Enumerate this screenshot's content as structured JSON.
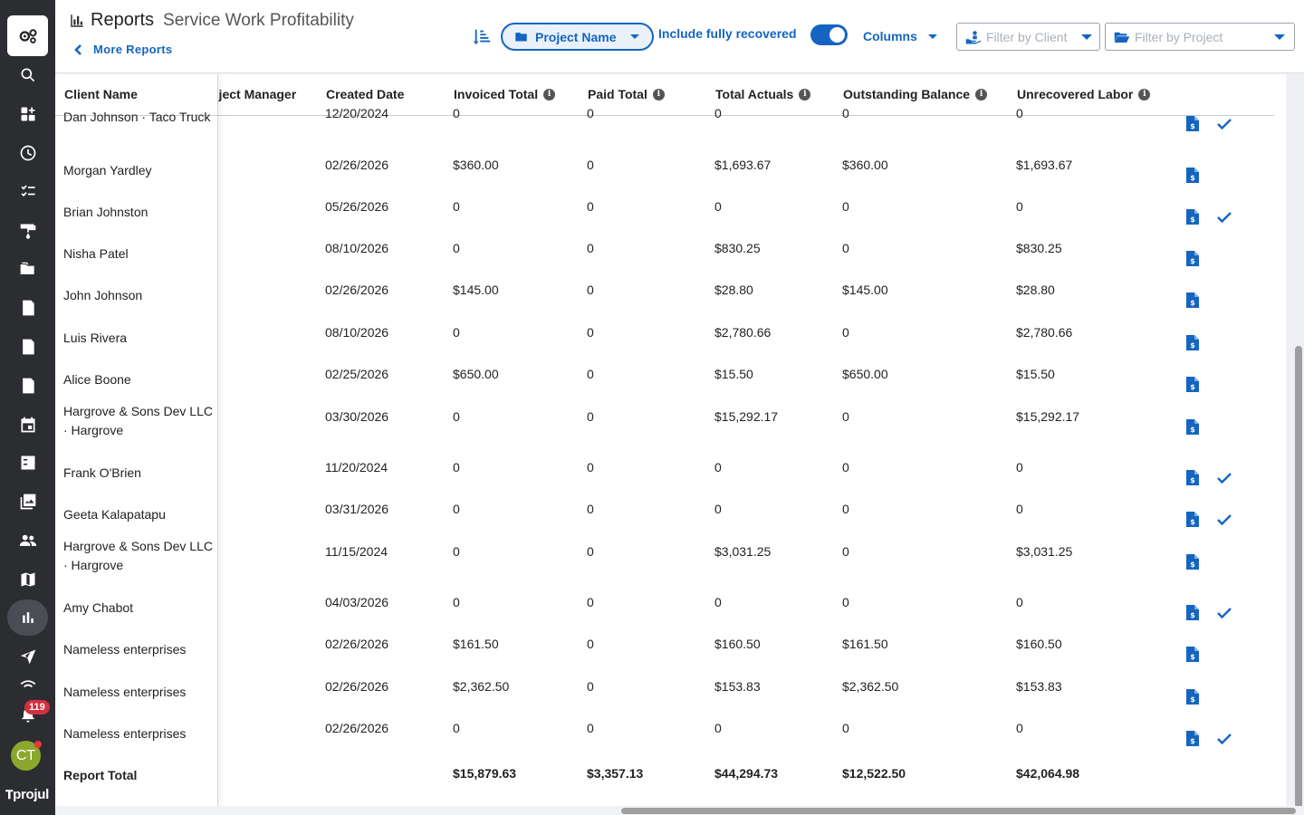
{
  "header": {
    "title": "Reports",
    "subtitle": "Service Work Profitability",
    "more_reports": "More Reports",
    "group_by": "Project Name",
    "include_recovered_label": "Include fully recovered",
    "include_recovered_on": true,
    "columns_label": "Columns",
    "filter_client_placeholder": "Filter by Client",
    "filter_project_placeholder": "Filter by Project"
  },
  "nav": {
    "notification_count": "119",
    "avatar_initials": "CT",
    "brand": "projul",
    "icons": [
      "settings-gears-icon",
      "search-icon",
      "dashboard-add-icon",
      "clock-icon",
      "checklist-icon",
      "paint-roller-icon",
      "folder-icon",
      "estimate-icon",
      "invoice-icon",
      "change-order-icon",
      "calendar-icon",
      "task-icon",
      "photos-icon",
      "users-icon",
      "map-icon",
      "reports-icon",
      "send-icon",
      "wifi-icon",
      "bell-icon"
    ]
  },
  "table": {
    "columns": {
      "client_name": "Client Name",
      "project_manager": "oject Manager",
      "created_date": "Created Date",
      "invoiced_total": "Invoiced Total",
      "paid_total": "Paid Total",
      "total_actuals": "Total Actuals",
      "outstanding_balance": "Outstanding Balance",
      "unrecovered_labor": "Unrecovered Labor"
    },
    "rows": [
      {
        "client": "Dan Johnson · Taco Truck",
        "date": "12/20/2024",
        "invoiced": "0",
        "paid": "0",
        "actuals": "0",
        "outstanding": "0",
        "unrecovered": "0",
        "check": true
      },
      {
        "client": "Morgan Yardley",
        "date": "02/26/2026",
        "invoiced": "$360.00",
        "paid": "0",
        "actuals": "$1,693.67",
        "outstanding": "$360.00",
        "unrecovered": "$1,693.67",
        "check": false
      },
      {
        "client": "Brian Johnston",
        "date": "05/26/2026",
        "invoiced": "0",
        "paid": "0",
        "actuals": "0",
        "outstanding": "0",
        "unrecovered": "0",
        "check": true
      },
      {
        "client": "Nisha Patel",
        "date": "08/10/2026",
        "invoiced": "0",
        "paid": "0",
        "actuals": "$830.25",
        "outstanding": "0",
        "unrecovered": "$830.25",
        "check": false
      },
      {
        "client": "John Johnson",
        "date": "02/26/2026",
        "invoiced": "$145.00",
        "paid": "0",
        "actuals": "$28.80",
        "outstanding": "$145.00",
        "unrecovered": "$28.80",
        "check": false
      },
      {
        "client": "Luis Rivera",
        "date": "08/10/2026",
        "invoiced": "0",
        "paid": "0",
        "actuals": "$2,780.66",
        "outstanding": "0",
        "unrecovered": "$2,780.66",
        "check": false
      },
      {
        "client": "Alice Boone",
        "date": "02/25/2026",
        "invoiced": "$650.00",
        "paid": "0",
        "actuals": "$15.50",
        "outstanding": "$650.00",
        "unrecovered": "$15.50",
        "check": false
      },
      {
        "client": "Hargrove & Sons Dev LLC · Hargrove",
        "date": "03/30/2026",
        "invoiced": "0",
        "paid": "0",
        "actuals": "$15,292.17",
        "outstanding": "0",
        "unrecovered": "$15,292.17",
        "check": false
      },
      {
        "client": "Frank O'Brien",
        "date": "11/20/2024",
        "invoiced": "0",
        "paid": "0",
        "actuals": "0",
        "outstanding": "0",
        "unrecovered": "0",
        "check": true
      },
      {
        "client": "Geeta Kalapatapu",
        "date": "03/31/2026",
        "invoiced": "0",
        "paid": "0",
        "actuals": "0",
        "outstanding": "0",
        "unrecovered": "0",
        "check": true
      },
      {
        "client": "Hargrove & Sons Dev LLC · Hargrove",
        "date": "11/15/2024",
        "invoiced": "0",
        "paid": "0",
        "actuals": "$3,031.25",
        "outstanding": "0",
        "unrecovered": "$3,031.25",
        "check": false
      },
      {
        "client": "Amy Chabot",
        "date": "04/03/2026",
        "invoiced": "0",
        "paid": "0",
        "actuals": "0",
        "outstanding": "0",
        "unrecovered": "0",
        "check": true
      },
      {
        "client": "Nameless enterprises",
        "date": "02/26/2026",
        "invoiced": "$161.50",
        "paid": "0",
        "actuals": "$160.50",
        "outstanding": "$161.50",
        "unrecovered": "$160.50",
        "check": false
      },
      {
        "client": "Nameless enterprises",
        "date": "02/26/2026",
        "invoiced": "$2,362.50",
        "paid": "0",
        "actuals": "$153.83",
        "outstanding": "$2,362.50",
        "unrecovered": "$153.83",
        "check": false
      },
      {
        "client": "Nameless enterprises",
        "date": "02/26/2026",
        "invoiced": "0",
        "paid": "0",
        "actuals": "0",
        "outstanding": "0",
        "unrecovered": "0",
        "check": true
      }
    ],
    "total": {
      "label": "Report Total",
      "invoiced": "$15,879.63",
      "paid": "$3,357.13",
      "actuals": "$44,294.73",
      "outstanding": "$12,522.50",
      "unrecovered": "$42,064.98"
    }
  },
  "colors": {
    "accent": "#1565c0",
    "rail": "#2b2d31",
    "badge": "#d32f3f",
    "avatar": "#8ba82c"
  }
}
